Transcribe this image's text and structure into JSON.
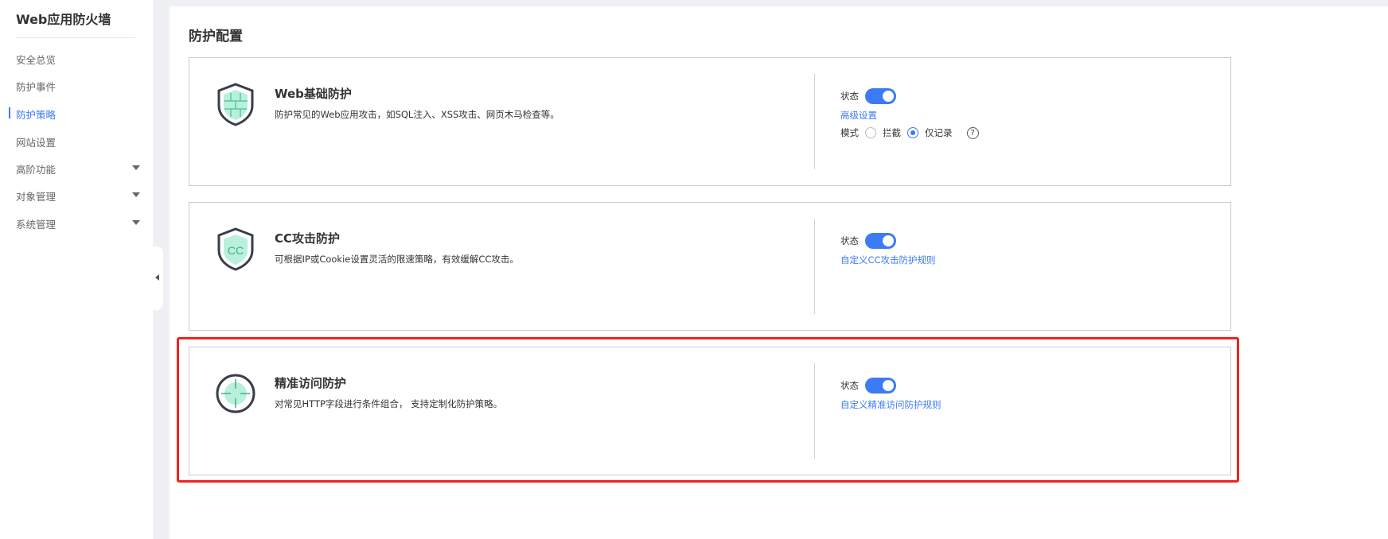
{
  "sidebar": {
    "title": "Web应用防火墙",
    "items": [
      {
        "label": "安全总览"
      },
      {
        "label": "防护事件"
      },
      {
        "label": "防护策略",
        "active": true
      },
      {
        "label": "网站设置"
      },
      {
        "label": "高阶功能",
        "expandable": true
      },
      {
        "label": "对象管理",
        "expandable": true
      },
      {
        "label": "系统管理",
        "expandable": true
      }
    ]
  },
  "page_title": "防护配置",
  "cards": [
    {
      "title": "Web基础防护",
      "desc": "防护常见的Web应用攻击，如SQL注入、XSS攻击、网页木马检查等。",
      "status_label": "状态",
      "status_on": true,
      "link": "高级设置",
      "mode_label": "模式",
      "mode_options": [
        "拦截",
        "仅记录"
      ],
      "mode_selected": "仅记录",
      "help": "?"
    },
    {
      "title": "CC攻击防护",
      "desc": "可根据IP或Cookie设置灵活的限速策略，有效缓解CC攻击。",
      "status_label": "状态",
      "status_on": true,
      "link": "自定义CC攻击防护规则",
      "icon_text": "CC"
    },
    {
      "title": "精准访问防护",
      "desc": "对常见HTTP字段进行条件组合， 支持定制化防护策略。",
      "status_label": "状态",
      "status_on": true,
      "link": "自定义精准访问防护规则"
    }
  ],
  "colors": {
    "accent": "#3d7af5",
    "highlight": "#f0231c",
    "icon_fill": "#b8f0dc"
  }
}
